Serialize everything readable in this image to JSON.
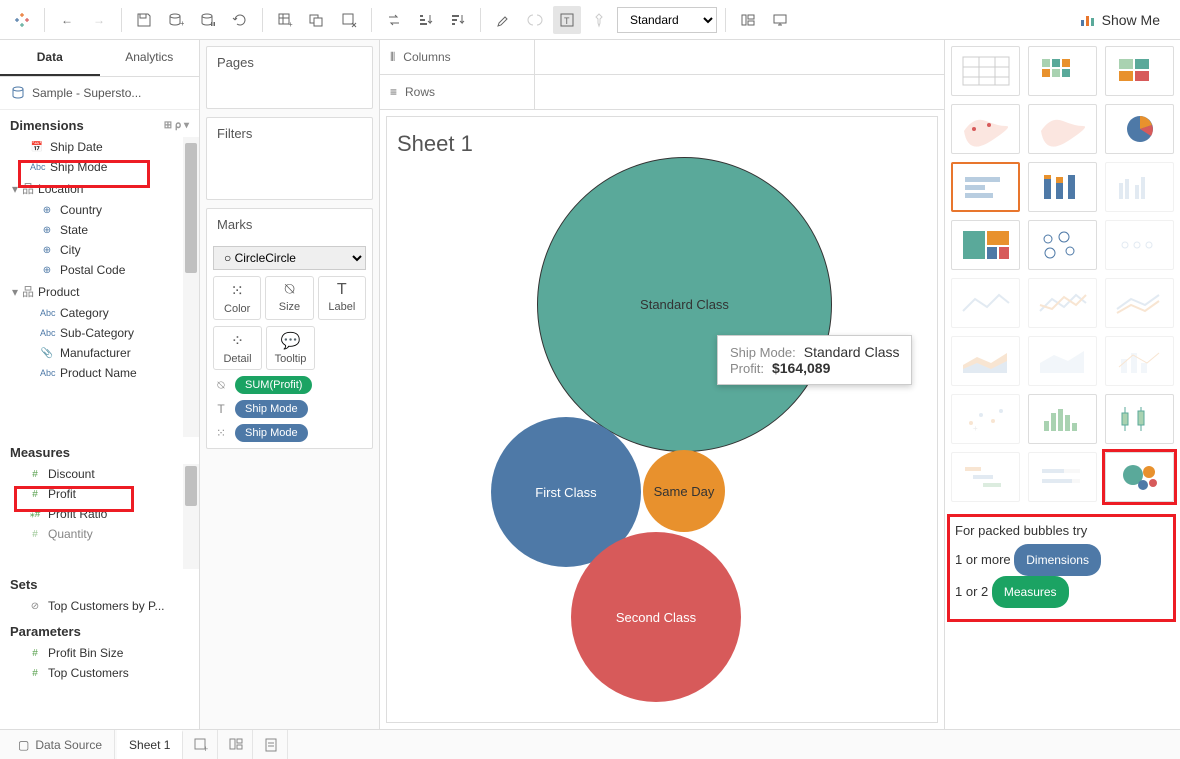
{
  "toolbar": {
    "fit_select": "Standard",
    "show_me_label": "Show Me"
  },
  "sidebar": {
    "tab_data": "Data",
    "tab_analytics": "Analytics",
    "datasource": "Sample - Supersto...",
    "dimensions_label": "Dimensions",
    "measures_label": "Measures",
    "sets_label": "Sets",
    "parameters_label": "Parameters",
    "dims": {
      "ship_date": "Ship Date",
      "ship_mode": "Ship Mode",
      "location": "Location",
      "country": "Country",
      "state": "State",
      "city": "City",
      "postal_code": "Postal Code",
      "product": "Product",
      "category": "Category",
      "sub_category": "Sub-Category",
      "manufacturer": "Manufacturer",
      "product_name": "Product Name"
    },
    "meas": {
      "discount": "Discount",
      "profit": "Profit",
      "profit_ratio": "Profit Ratio",
      "quantity": "Quantity"
    },
    "sets": {
      "top_customers": "Top Customers by P..."
    },
    "params": {
      "profit_bin": "Profit Bin Size",
      "top_customers": "Top Customers"
    }
  },
  "shelves": {
    "pages_label": "Pages",
    "filters_label": "Filters",
    "marks_label": "Marks",
    "marks_type": "Circle",
    "color": "Color",
    "size": "Size",
    "label": "Label",
    "detail": "Detail",
    "tooltip": "Tooltip",
    "pill_sum_profit": "SUM(Profit)",
    "pill_ship_mode": "Ship Mode",
    "columns_label": "Columns",
    "rows_label": "Rows"
  },
  "viz": {
    "title": "Sheet 1",
    "tooltip": {
      "l1": "Ship Mode:",
      "v1": "Standard Class",
      "l2": "Profit:",
      "v2": "$164,089"
    }
  },
  "chart_data": {
    "type": "packed_bubbles",
    "size_measure": "Profit",
    "color_dimension": "Ship Mode",
    "bubbles": [
      {
        "label": "Standard Class",
        "profit": 164089,
        "color": "#5aa99a"
      },
      {
        "label": "First Class",
        "profit": 45000,
        "color": "#4e79a7"
      },
      {
        "label": "Second Class",
        "profit": 55000,
        "color": "#d75a5a"
      },
      {
        "label": "Same Day",
        "profit": 14000,
        "color": "#e8912d"
      }
    ]
  },
  "showme": {
    "help_line1": "For packed bubbles try",
    "help_line2a": "1 or more ",
    "help_dim": "Dimensions",
    "help_line3a": "1 or 2 ",
    "help_meas": "Measures"
  },
  "bottom": {
    "data_source": "Data Source",
    "sheet": "Sheet 1"
  }
}
